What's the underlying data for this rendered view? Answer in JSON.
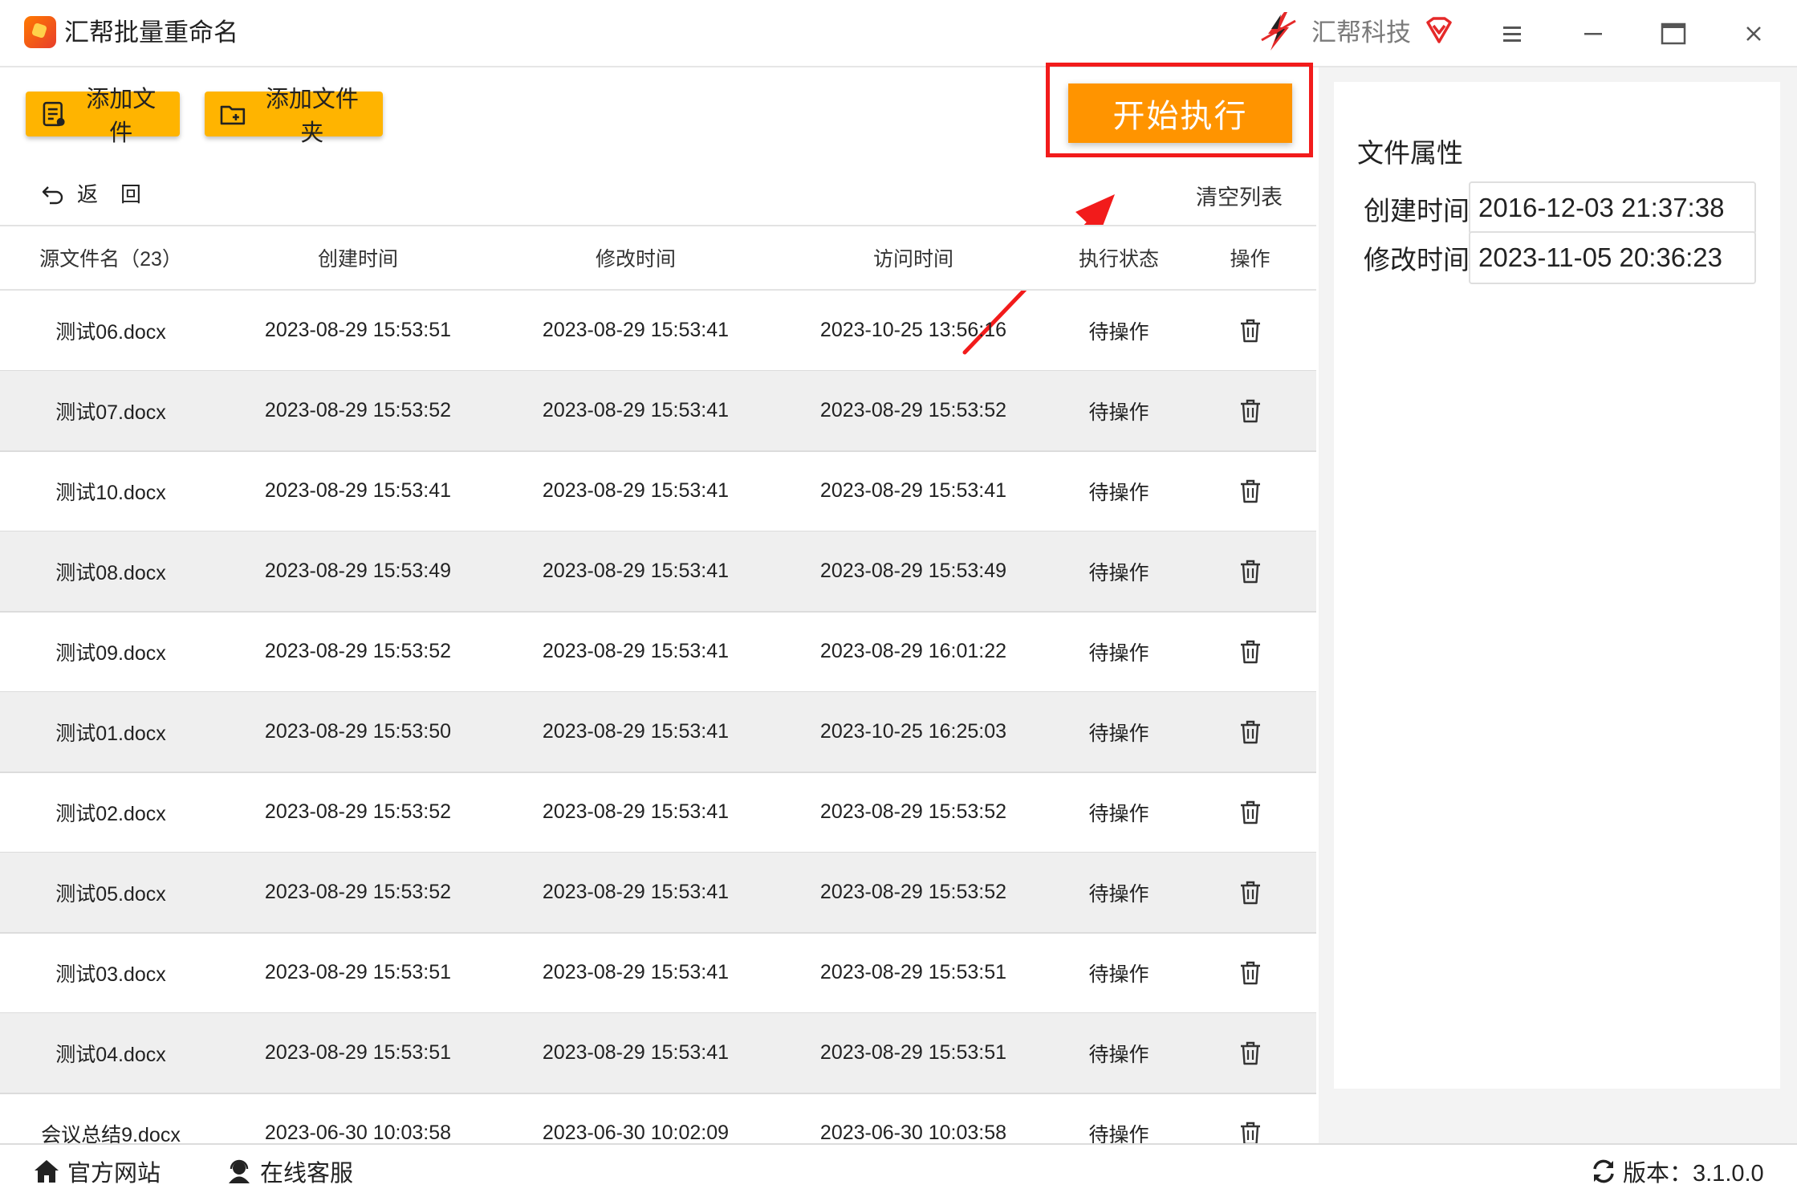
{
  "app": {
    "title": "汇帮批量重命名",
    "brand": "汇帮科技"
  },
  "toolbar": {
    "add_file": "添加文件",
    "add_folder": "添加文件夹",
    "start": "开始执行",
    "back": "返回",
    "clear": "清空列表"
  },
  "table": {
    "headers": [
      "源文件名（23）",
      "创建时间",
      "修改时间",
      "访问时间",
      "执行状态",
      "操作"
    ],
    "rows": [
      {
        "name": "测试06.docx",
        "created": "2023-08-29 15:53:51",
        "modified": "2023-08-29 15:53:41",
        "accessed": "2023-10-25 13:56:16",
        "status": "待操作"
      },
      {
        "name": "测试07.docx",
        "created": "2023-08-29 15:53:52",
        "modified": "2023-08-29 15:53:41",
        "accessed": "2023-08-29 15:53:52",
        "status": "待操作"
      },
      {
        "name": "测试10.docx",
        "created": "2023-08-29 15:53:41",
        "modified": "2023-08-29 15:53:41",
        "accessed": "2023-08-29 15:53:41",
        "status": "待操作"
      },
      {
        "name": "测试08.docx",
        "created": "2023-08-29 15:53:49",
        "modified": "2023-08-29 15:53:41",
        "accessed": "2023-08-29 15:53:49",
        "status": "待操作"
      },
      {
        "name": "测试09.docx",
        "created": "2023-08-29 15:53:52",
        "modified": "2023-08-29 15:53:41",
        "accessed": "2023-08-29 16:01:22",
        "status": "待操作"
      },
      {
        "name": "测试01.docx",
        "created": "2023-08-29 15:53:50",
        "modified": "2023-08-29 15:53:41",
        "accessed": "2023-10-25 16:25:03",
        "status": "待操作"
      },
      {
        "name": "测试02.docx",
        "created": "2023-08-29 15:53:52",
        "modified": "2023-08-29 15:53:41",
        "accessed": "2023-08-29 15:53:52",
        "status": "待操作"
      },
      {
        "name": "测试05.docx",
        "created": "2023-08-29 15:53:52",
        "modified": "2023-08-29 15:53:41",
        "accessed": "2023-08-29 15:53:52",
        "status": "待操作"
      },
      {
        "name": "测试03.docx",
        "created": "2023-08-29 15:53:51",
        "modified": "2023-08-29 15:53:41",
        "accessed": "2023-08-29 15:53:51",
        "status": "待操作"
      },
      {
        "name": "测试04.docx",
        "created": "2023-08-29 15:53:51",
        "modified": "2023-08-29 15:53:41",
        "accessed": "2023-08-29 15:53:51",
        "status": "待操作"
      },
      {
        "name": "会议总结9.docx",
        "created": "2023-06-30 10:03:58",
        "modified": "2023-06-30 10:02:09",
        "accessed": "2023-06-30 10:03:58",
        "status": "待操作"
      }
    ]
  },
  "properties": {
    "title": "文件属性",
    "created_label": "创建时间",
    "created_value": "2016-12-03 21:37:38",
    "modified_label": "修改时间",
    "modified_value": "2023-11-05 20:36:23"
  },
  "footer": {
    "website": "官方网站",
    "service": "在线客服",
    "version": "版本：3.1.0.0"
  },
  "colors": {
    "toolbar_button": "#ffb400",
    "start_button": "#ff9400",
    "highlight": "#f21b1b",
    "alt_row": "#efefef"
  },
  "icons": [
    "app-logo-icon",
    "brand-logo-icon",
    "vip-icon",
    "menu-icon",
    "minimize-icon",
    "maximize-icon",
    "close-icon",
    "add-file-icon",
    "add-folder-icon",
    "back-arrow-icon",
    "trash-icon",
    "home-icon",
    "customer-service-icon",
    "refresh-icon"
  ]
}
